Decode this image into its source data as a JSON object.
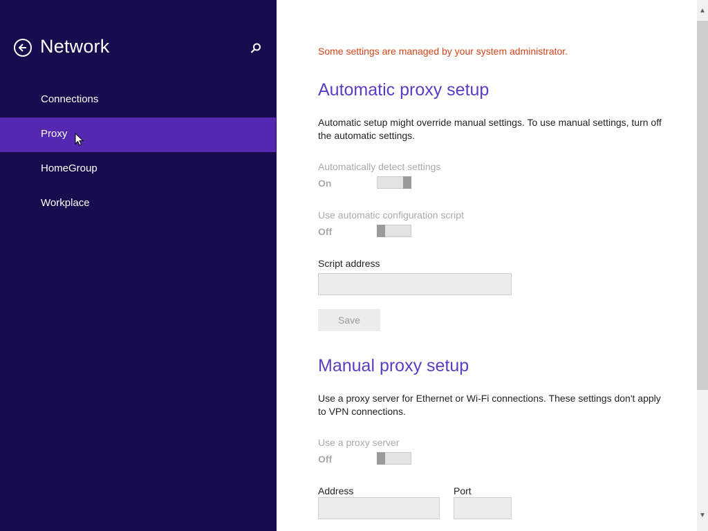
{
  "sidebar": {
    "title": "Network",
    "back_icon": "back-arrow-circle-icon",
    "search_icon": "search-icon",
    "items": [
      {
        "label": "Connections",
        "active": false
      },
      {
        "label": "Proxy",
        "active": true
      },
      {
        "label": "HomeGroup",
        "active": false
      },
      {
        "label": "Workplace",
        "active": false
      }
    ],
    "colors": {
      "background": "#180b4e",
      "active": "#5428b0"
    }
  },
  "main": {
    "admin_note": "Some settings are managed by your system administrator.",
    "automatic": {
      "title": "Automatic proxy setup",
      "description": "Automatic setup might override manual settings. To use manual settings, turn off the automatic settings.",
      "detect_label": "Automatically detect settings",
      "detect_state": "On",
      "script_label": "Use automatic configuration script",
      "script_state": "Off",
      "script_address_label": "Script address",
      "script_address_value": "",
      "save_label": "Save"
    },
    "manual": {
      "title": "Manual proxy setup",
      "description": "Use a proxy server for Ethernet or Wi-Fi connections. These settings don't apply to VPN connections.",
      "use_proxy_label": "Use a proxy server",
      "use_proxy_state": "Off",
      "address_label": "Address",
      "address_value": "",
      "port_label": "Port",
      "port_value": ""
    },
    "colors": {
      "accent": "#5b3cc4",
      "warning": "#d3431b"
    }
  }
}
